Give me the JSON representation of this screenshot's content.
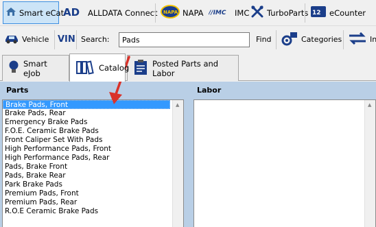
{
  "toolbar": {
    "smart_ecat": "Smart eCat",
    "alldata": "ALLDATA Connect",
    "napa": "NAPA",
    "imc": "IMC",
    "turboparts": "TurboParts",
    "ecounter": "eCounter"
  },
  "searchbar": {
    "vehicle": "Vehicle",
    "vin": "VIN",
    "search_label": "Search:",
    "search_value": "Pads",
    "find": "Find",
    "categories": "Categories",
    "cut_label": "In"
  },
  "tabs": [
    {
      "label": "Smart eJob"
    },
    {
      "label": "Catalog"
    },
    {
      "label": "Posted Parts and Labor"
    }
  ],
  "parts": {
    "title": "Parts",
    "items": [
      "Brake Pads, Front",
      "Brake Pads, Rear",
      "Emergency Brake Pads",
      "F.O.E. Ceramic Brake Pads",
      "Front Caliper Set With Pads",
      "High Performance Pads, Front",
      "High Performance Pads, Rear",
      "Pads, Brake Front",
      "Pads, Brake Rear",
      "Park Brake Pads",
      "Premium Pads, Front",
      "Premium Pads, Rear",
      "R.O.E Ceramic Brake Pads"
    ],
    "selected_index": 0
  },
  "labor": {
    "title": "Labor"
  },
  "colors": {
    "selection": "#3399ff",
    "pane_background": "#b9cfe6",
    "annotation_arrow": "#d9322a"
  }
}
